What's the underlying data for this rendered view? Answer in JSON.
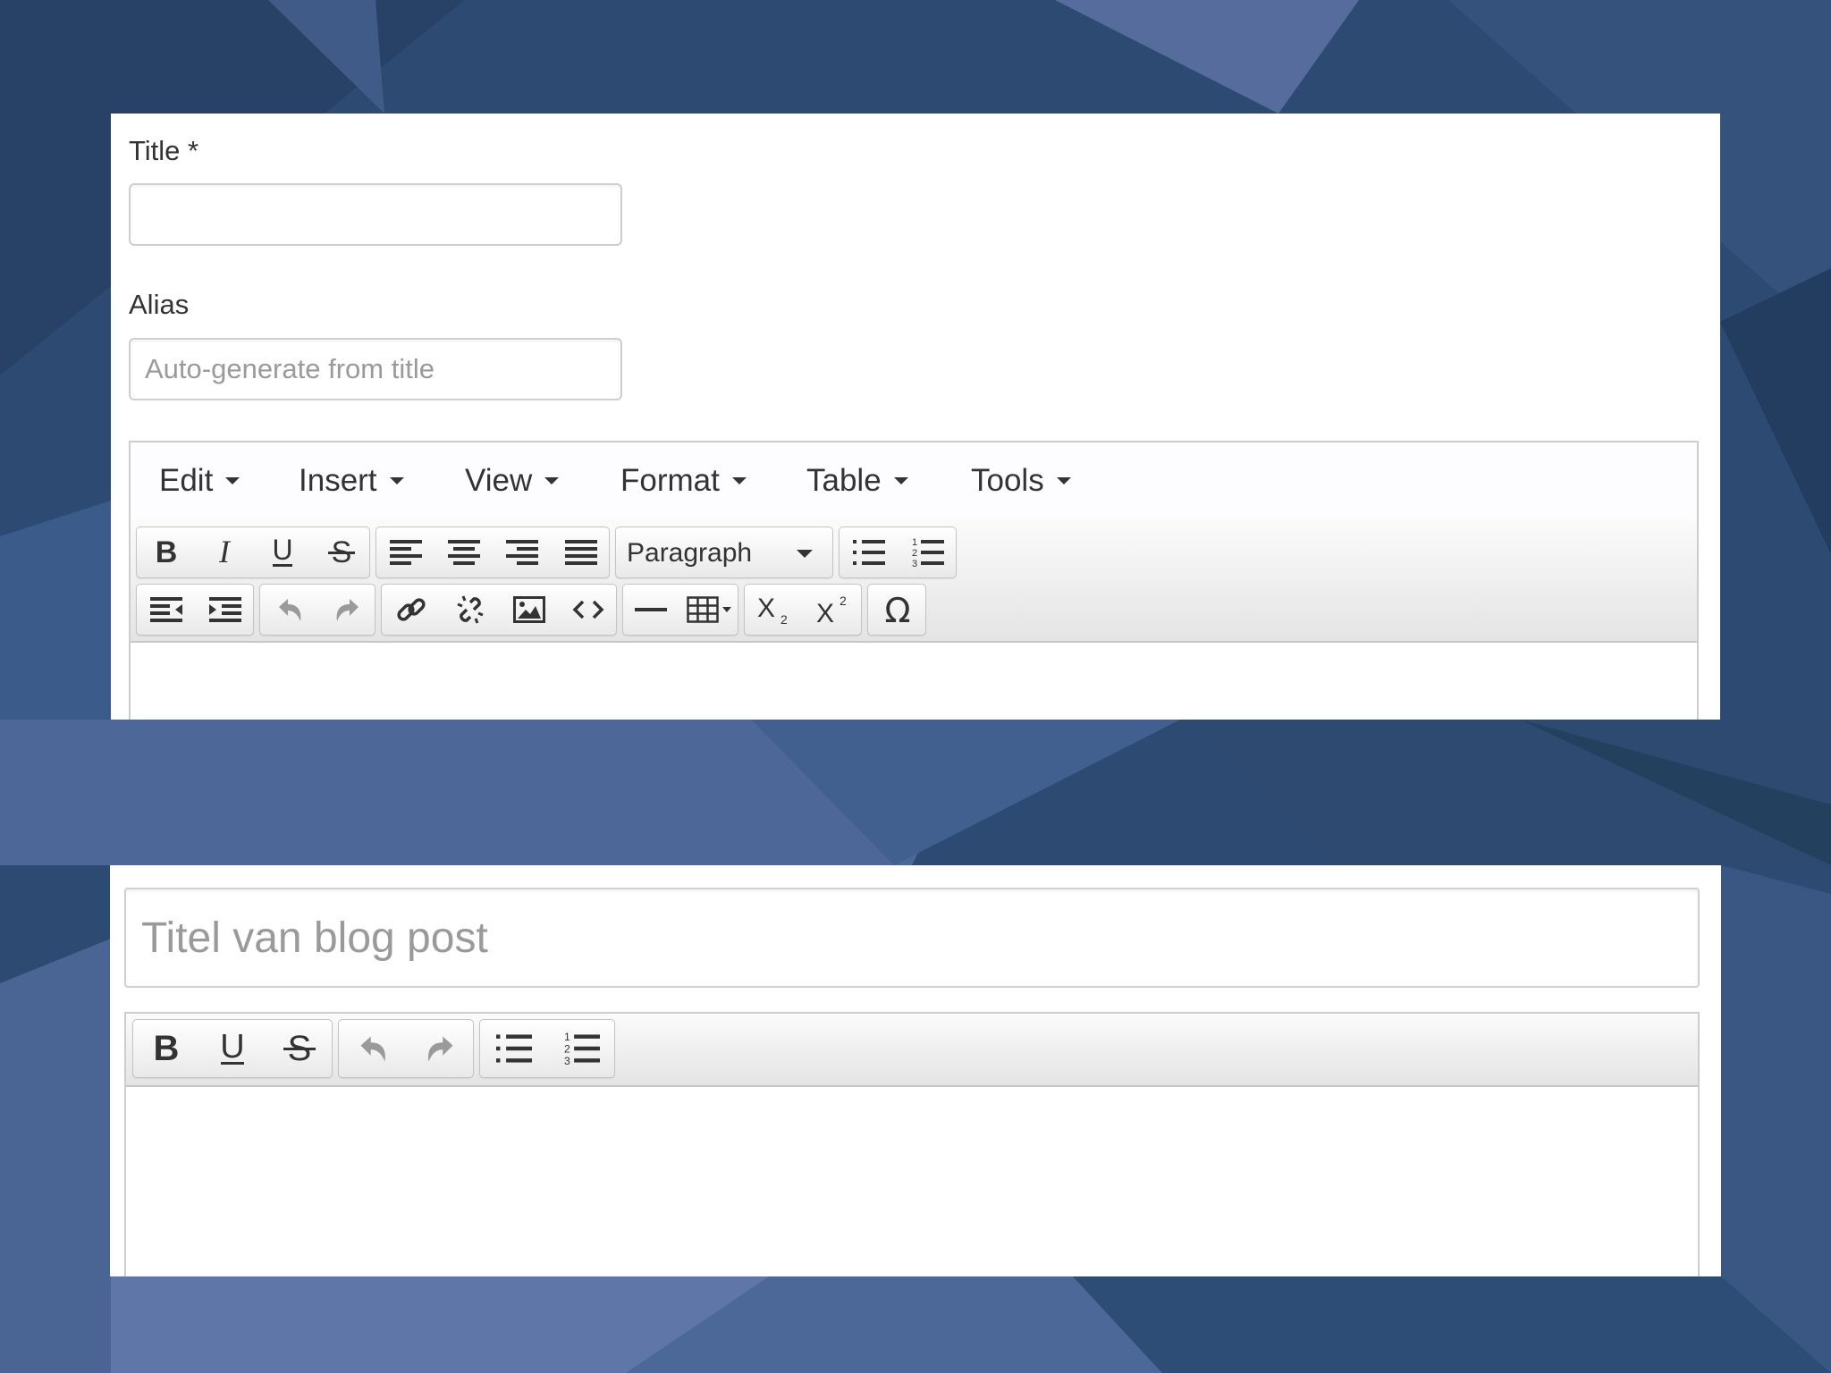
{
  "form": {
    "title_label": "Title *",
    "title_value": "",
    "alias_label": "Alias",
    "alias_placeholder": "Auto-generate from title"
  },
  "editor": {
    "menu": [
      "Edit",
      "Insert",
      "View",
      "Format",
      "Table",
      "Tools"
    ],
    "format_select": "Paragraph",
    "content": ""
  },
  "blog": {
    "title_placeholder": "Titel van blog post",
    "title_value": "",
    "content": ""
  }
}
